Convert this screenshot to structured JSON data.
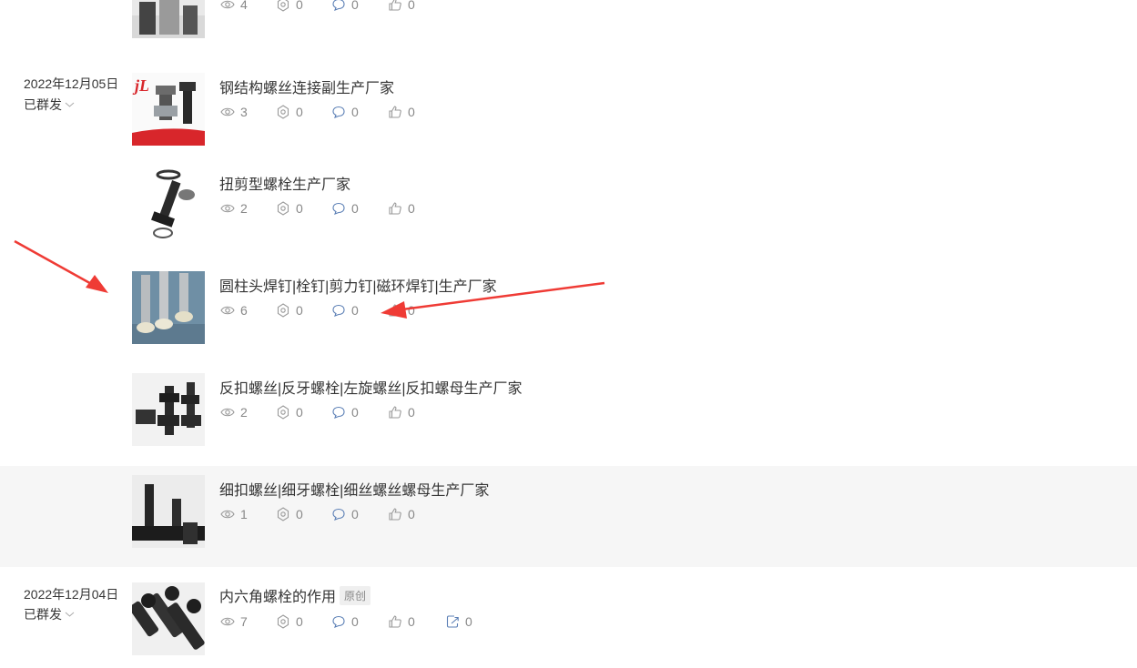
{
  "colors": {
    "arrow": "#ef3b35",
    "highlight_row": "#f6f6f6",
    "text": "#353535",
    "muted": "#888888"
  },
  "groups": [
    {
      "date": "2022年12月05日",
      "status": "已群发"
    },
    {
      "date": "2022年12月04日",
      "status": "已群发"
    }
  ],
  "articles": [
    {
      "title": "",
      "views": "4",
      "settings": "0",
      "comments": "0",
      "likes": "0"
    },
    {
      "title": "钢结构螺丝连接副生产厂家",
      "views": "3",
      "settings": "0",
      "comments": "0",
      "likes": "0"
    },
    {
      "title": "扭剪型螺栓生产厂家",
      "views": "2",
      "settings": "0",
      "comments": "0",
      "likes": "0"
    },
    {
      "title": "圆柱头焊钉|栓钉|剪力钉|磁环焊钉|生产厂家",
      "views": "6",
      "settings": "0",
      "comments": "0",
      "likes": "0"
    },
    {
      "title": "反扣螺丝|反牙螺栓|左旋螺丝|反扣螺母生产厂家",
      "views": "2",
      "settings": "0",
      "comments": "0",
      "likes": "0"
    },
    {
      "title": "细扣螺丝|细牙螺栓|细丝螺丝螺母生产厂家",
      "views": "1",
      "settings": "0",
      "comments": "0",
      "likes": "0"
    },
    {
      "title": "内六角螺栓的作用",
      "tag": "原创",
      "views": "7",
      "settings": "0",
      "comments": "0",
      "likes": "0",
      "shares": "0"
    }
  ]
}
